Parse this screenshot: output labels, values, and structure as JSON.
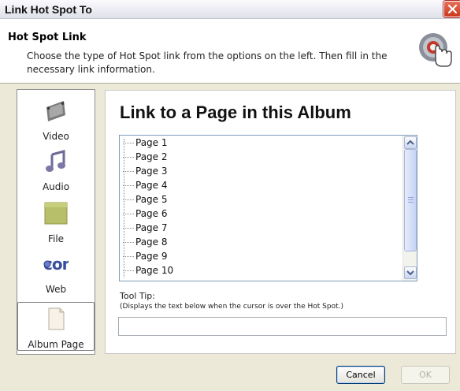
{
  "window": {
    "title": "Link Hot Spot To"
  },
  "header": {
    "title": "Hot Spot Link",
    "description": "Choose the type of Hot Spot link from the options on the left. Then fill in the necessary link information.",
    "icon": "hotspot-hand-icon"
  },
  "sidebar": {
    "items": [
      {
        "label": "Video",
        "icon": "film-icon"
      },
      {
        "label": "Audio",
        "icon": "music-note-icon"
      },
      {
        "label": "File",
        "icon": "folder-icon"
      },
      {
        "label": "Web",
        "icon": "web-globe-icon"
      },
      {
        "label": "Album Page",
        "icon": "page-icon",
        "selected": true
      }
    ]
  },
  "main": {
    "title": "Link to a Page in this Album",
    "pages": [
      "Page 1",
      "Page 2",
      "Page 3",
      "Page 4",
      "Page 5",
      "Page 6",
      "Page 7",
      "Page 8",
      "Page 9",
      "Page 10"
    ],
    "tooltip_label": "Tool Tip:",
    "tooltip_hint": "(Displays the text below when the cursor is over the Hot Spot.)",
    "tooltip_value": ""
  },
  "buttons": {
    "cancel": "Cancel",
    "ok": "OK"
  },
  "colors": {
    "accent_border": "#003c74",
    "close": "#c9391c",
    "panel_bg": "#ece9d8"
  }
}
